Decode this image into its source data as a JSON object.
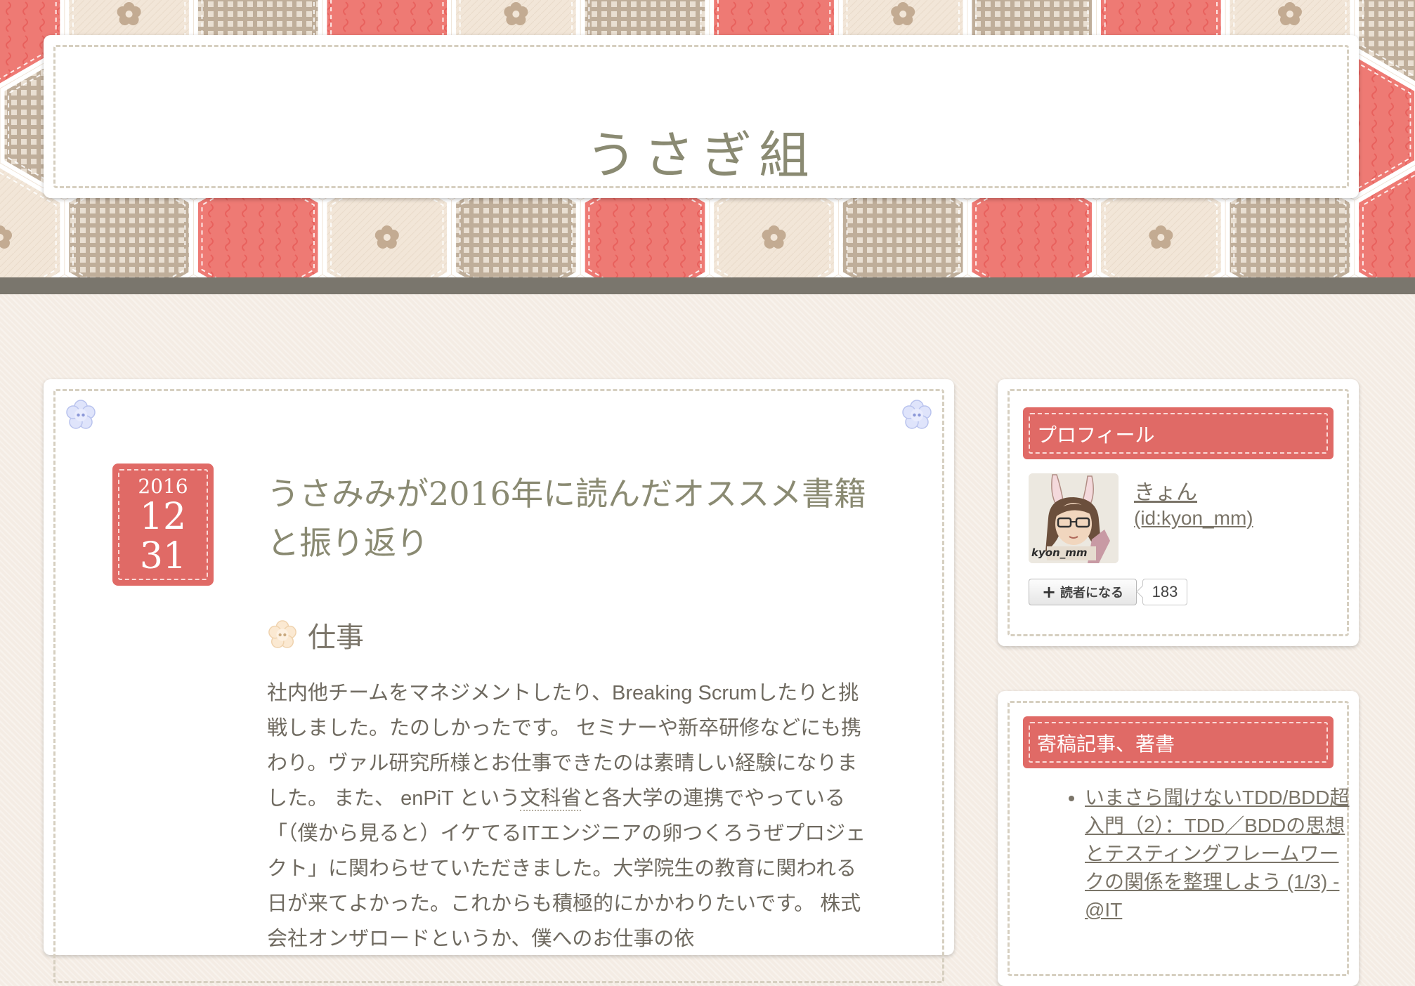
{
  "site": {
    "title": "うさぎ組"
  },
  "entry": {
    "date": {
      "year": "2016",
      "month": "12",
      "day": "31"
    },
    "title": "うさみみが2016年に読んだオススメ書籍と振り返り",
    "section_heading": "仕事",
    "body_before_link": "社内他チームをマネジメントしたり、Breaking Scrumしたりと挑戦しました。たのしかったです。 セミナーや新卒研修などにも携わり。ヴァル研究所様とお仕事できたのは素晴しい経験になりました。 また、 enPiT という",
    "body_link": "文科省",
    "body_after_link": "と各大学の連携でやっている「（僕から見ると）イケてるITエンジニアの卵つくろうぜプロジェクト」に関わらせていただきました。大学院生の教育に関われる日が来てよかった。これからも積極的にかかわりたいです。 株式会社オンザロードというか、僕へのお仕事の依"
  },
  "sidebar": {
    "profile": {
      "heading": "プロフィール",
      "name": "きょん",
      "id_text": "(id:kyon_mm)",
      "avatar_caption": "kyon_mm",
      "subscribe_label": "読者になる",
      "subscriber_count": "183"
    },
    "articles": {
      "heading": "寄稿記事、著書",
      "items": [
        "いまさら聞けないTDD/BDD超入門（2）：TDD／BDDの思想とテスティングフレームワークの関係を整理しよう (1/3) - @IT"
      ]
    }
  },
  "colors": {
    "accent_red": "#e06a66",
    "hex_tan": "#bfae9a",
    "rule_gray": "#7a766d",
    "background": "#f4ece4"
  }
}
